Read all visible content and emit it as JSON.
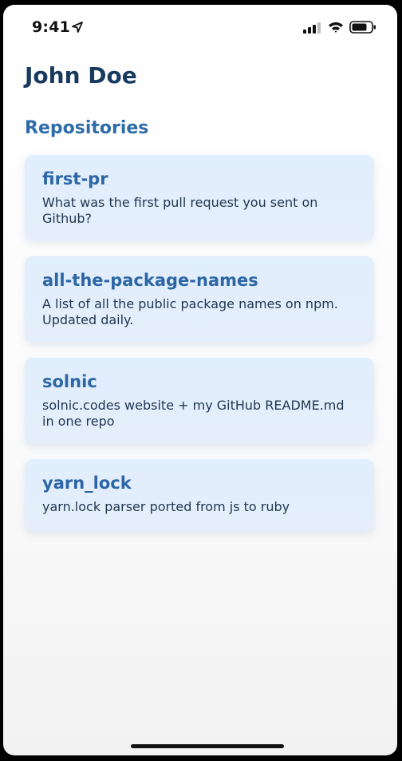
{
  "status_bar": {
    "time": "9:41"
  },
  "profile": {
    "name": "John Doe"
  },
  "repositories": {
    "title": "Repositories",
    "items": [
      {
        "name": "first-pr",
        "description": "What was the first pull request you sent on Github?"
      },
      {
        "name": "all-the-package-names",
        "description": "A list of all the public package names on npm. Updated daily."
      },
      {
        "name": "solnic",
        "description": "solnic.codes website + my GitHub README.md in one repo"
      },
      {
        "name": "yarn_lock",
        "description": "yarn.lock parser ported from js to ruby"
      }
    ]
  },
  "icons": {
    "location": "location-arrow-icon",
    "signal": "cellular-signal-icon",
    "wifi": "wifi-icon",
    "battery": "battery-icon"
  },
  "colors": {
    "name": "#173a5e",
    "accent": "#2d6ca8",
    "card_background": "#e1eefc"
  }
}
